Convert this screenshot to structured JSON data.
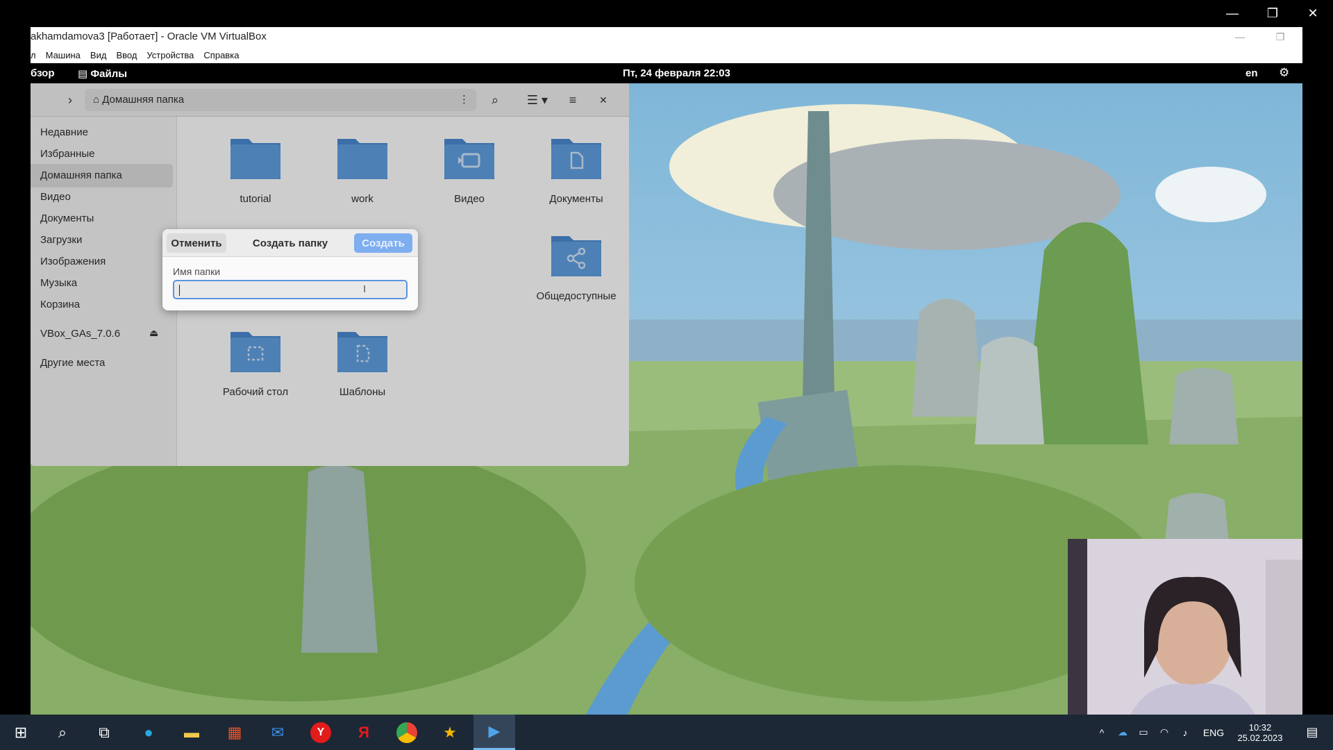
{
  "host": {
    "minimize": "—",
    "restore": "❐",
    "close": "✕"
  },
  "vbox": {
    "title": "akhamdamova3 [Работает] - Oracle VM VirtualBox",
    "menu": [
      "л",
      "Машина",
      "Вид",
      "Ввод",
      "Устройства",
      "Справка"
    ]
  },
  "gnome": {
    "overview": "бзор",
    "app_name": "Файлы",
    "clock": "Пт, 24 февраля  22:03",
    "lang": "en"
  },
  "files": {
    "path": "Домашняя папка",
    "sidebar": [
      {
        "label": "Недавние"
      },
      {
        "label": "Избранные"
      },
      {
        "label": "Домашняя папка"
      },
      {
        "label": "Видео"
      },
      {
        "label": "Документы"
      },
      {
        "label": "Загрузки"
      },
      {
        "label": "Изображения"
      },
      {
        "label": "Музыка"
      },
      {
        "label": "Корзина"
      },
      {
        "label": "VBox_GAs_7.0.6"
      },
      {
        "label": "Другие места"
      }
    ],
    "folders": [
      {
        "label": "tutorial",
        "icon": "folder-icon"
      },
      {
        "label": "work",
        "icon": "folder-icon"
      },
      {
        "label": "Видео",
        "icon": "folder-video-icon"
      },
      {
        "label": "Документы",
        "icon": "folder-documents-icon"
      },
      {
        "label": "Общедоступные",
        "icon": "folder-share-icon"
      },
      {
        "label": "Рабочий стол",
        "icon": "folder-desktop-icon"
      },
      {
        "label": "Шаблоны",
        "icon": "folder-templates-icon"
      }
    ]
  },
  "dialog": {
    "cancel": "Отменить",
    "title": "Создать папку",
    "create": "Создать",
    "field_label": "Имя папки",
    "field_value": ""
  },
  "taskbar": {
    "lang": "ENG",
    "time": "10:32",
    "date": "25.02.2023"
  },
  "colors": {
    "accent": "#5a93e0",
    "create_button": "#7eaef0",
    "taskbar": "#1c2836",
    "folder": "#5e9ddd"
  }
}
